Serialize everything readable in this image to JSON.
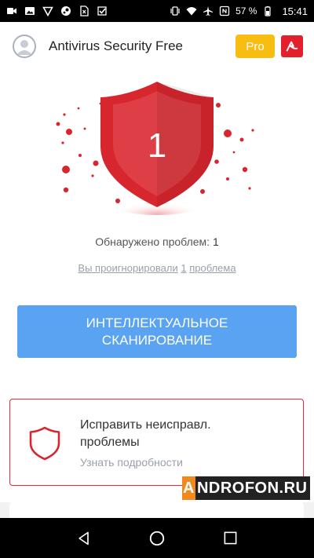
{
  "status_bar": {
    "battery": "57 %",
    "time": "15:41",
    "left_icons": [
      "video-icon",
      "image-icon",
      "vpn-icon",
      "steam-icon",
      "sim-icon",
      "check-icon"
    ],
    "right_icons": [
      "vibrate-icon",
      "wifi-icon",
      "airplane-icon",
      "nfc-icon",
      "battery-icon"
    ]
  },
  "header": {
    "title": "Antivirus Security Free",
    "pro_label": "Pro"
  },
  "shield": {
    "count": "1",
    "color": "#d8262e"
  },
  "status": {
    "problems_label": "Обнаружено проблем:",
    "problems_count": "1",
    "ignored_prefix": "Вы проигнорировали",
    "ignored_count": "1",
    "ignored_suffix": "проблема"
  },
  "scan_button": {
    "line1": "ИНТЕЛЛЕКТУАЛЬНОЕ",
    "line2": "СКАНИРОВАНИЕ",
    "color": "#5aa3f2"
  },
  "issue_card": {
    "title_line1": "Исправить неисправл.",
    "title_line2": "проблемы",
    "subtitle": "Узнать подробности"
  },
  "watermark": {
    "first": "A",
    "rest": "NDROFON.RU"
  },
  "nav": [
    "back-icon",
    "home-icon",
    "recents-icon"
  ]
}
